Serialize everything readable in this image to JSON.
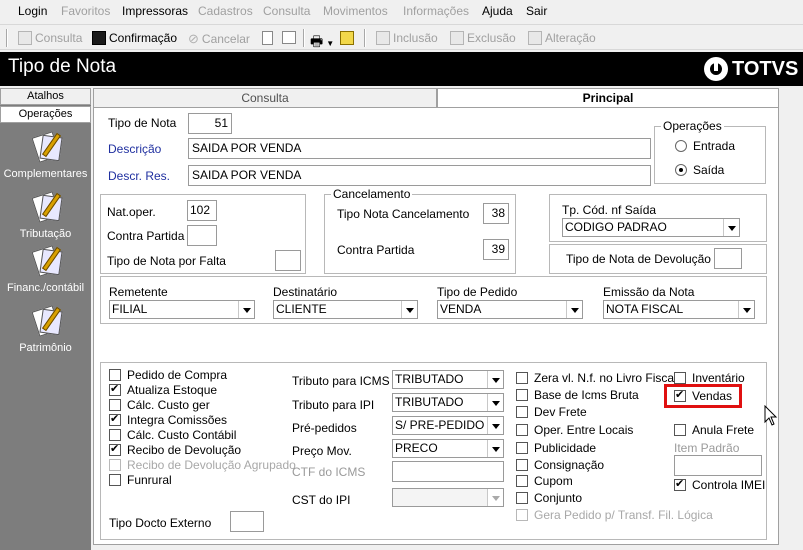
{
  "menu": {
    "items": [
      {
        "label": "Login",
        "enabled": true
      },
      {
        "label": "Favoritos",
        "enabled": false
      },
      {
        "label": "Impressoras",
        "enabled": true
      },
      {
        "label": "Cadastros",
        "enabled": false
      },
      {
        "label": "Consulta",
        "enabled": false
      },
      {
        "label": "Movimentos",
        "enabled": false
      },
      {
        "label": "Informações",
        "enabled": false
      },
      {
        "label": "Ajuda",
        "enabled": true
      },
      {
        "label": "Sair",
        "enabled": true
      }
    ]
  },
  "toolbar": {
    "consulta": "Consulta",
    "confirmacao": "Confirmação",
    "cancelar": "Cancelar",
    "inclusao": "Inclusão",
    "exclusao": "Exclusão",
    "alteracao": "Alteração"
  },
  "title_bar": {
    "title": "Tipo de Nota",
    "brand": "TOTVS"
  },
  "sidebar": {
    "tabs": [
      "Atalhos",
      "Operações"
    ],
    "items": [
      "Complementares",
      "Tributação",
      "Financ./contábil",
      "Patrimônio"
    ]
  },
  "tabs": {
    "consulta": "Consulta",
    "principal": "Principal"
  },
  "form": {
    "tipo_de_nota": {
      "label": "Tipo de Nota",
      "value": "51"
    },
    "descricao": {
      "label": "Descrição",
      "value": "SAIDA POR VENDA"
    },
    "descr_res": {
      "label": "Descr. Res.",
      "value": "SAIDA POR VENDA"
    },
    "operacoes": {
      "label": "Operações",
      "options": [
        "Entrada",
        "Saída"
      ],
      "selected": "Saída"
    },
    "nat_oper": {
      "label": "Nat.oper.",
      "value": "102"
    },
    "contra_partida": {
      "label": "Contra Partida",
      "value": ""
    },
    "tipo_nota_falta": {
      "label": "Tipo de Nota por Falta",
      "value": ""
    },
    "cancelamento": {
      "label": "Cancelamento",
      "tipo_nota_canc": {
        "label": "Tipo Nota Cancelamento",
        "value": "38"
      },
      "contra_partida": {
        "label": "Contra Partida",
        "value": "39"
      }
    },
    "tp_cod_nf_saida": {
      "label": "Tp. Cód. nf Saída",
      "value": "CODIGO PADRAO"
    },
    "tipo_nota_devolucao": {
      "label": "Tipo de Nota de Devolução",
      "value": ""
    },
    "remetente": {
      "label": "Remetente",
      "value": "FILIAL"
    },
    "destinatario": {
      "label": "Destinatário",
      "value": "CLIENTE"
    },
    "tipo_pedido": {
      "label": "Tipo de Pedido",
      "value": "VENDA"
    },
    "emissao_nota": {
      "label": "Emissão da Nota",
      "value": "NOTA FISCAL"
    },
    "checks_col1": [
      {
        "label": "Pedido de Compra",
        "checked": false,
        "enabled": true
      },
      {
        "label": "Atualiza Estoque",
        "checked": true,
        "enabled": true
      },
      {
        "label": "Cálc. Custo ger",
        "checked": false,
        "enabled": true
      },
      {
        "label": "Integra Comissões",
        "checked": true,
        "enabled": true
      },
      {
        "label": "Cálc. Custo Contábil",
        "checked": false,
        "enabled": true
      },
      {
        "label": "Recibo de Devolução",
        "checked": true,
        "enabled": true
      },
      {
        "label": "Recibo de Devolução Agrupado",
        "checked": false,
        "enabled": false
      },
      {
        "label": "Funrural",
        "checked": false,
        "enabled": true
      }
    ],
    "tipo_docto_externo": {
      "label": "Tipo Docto Externo",
      "value": ""
    },
    "tributo_icms": {
      "label": "Tributo para ICMS",
      "value": "TRIBUTADO"
    },
    "tributo_ipi": {
      "label": "Tributo para IPI",
      "value": "TRIBUTADO"
    },
    "pre_pedidos": {
      "label": "Pré-pedidos",
      "value": "S/ PRE-PEDIDO"
    },
    "preco_mov": {
      "label": "Preço Mov.",
      "value": "PRECO"
    },
    "ctf_icms": {
      "label": "CTF do ICMS",
      "value": ""
    },
    "cst_ipi": {
      "label": "CST do IPI",
      "value": ""
    },
    "checks_col3": [
      {
        "label": "Zera vl. N.f. no Livro Fiscal",
        "checked": false,
        "enabled": true
      },
      {
        "label": "Base de Icms Bruta",
        "checked": false,
        "enabled": true
      },
      {
        "label": "Dev Frete",
        "checked": false,
        "enabled": true
      },
      {
        "label": "Oper. Entre Locais",
        "checked": false,
        "enabled": true
      },
      {
        "label": "Publicidade",
        "checked": false,
        "enabled": true
      },
      {
        "label": "Consignação",
        "checked": false,
        "enabled": true
      },
      {
        "label": "Cupom",
        "checked": false,
        "enabled": true
      },
      {
        "label": "Conjunto",
        "checked": false,
        "enabled": true
      },
      {
        "label": "Gera Pedido p/ Transf. Fil. Lógica",
        "checked": false,
        "enabled": false
      }
    ],
    "inventario": {
      "label": "Inventário",
      "checked": false
    },
    "vendas": {
      "label": "Vendas",
      "checked": true
    },
    "anula_frete": {
      "label": "Anula Frete",
      "checked": false
    },
    "item_padrao": {
      "label": "Item Padrão",
      "value": ""
    },
    "controla_imei": {
      "label": "Controla IMEI",
      "checked": true
    }
  },
  "colors": {
    "highlight": "#e01010",
    "sidebar": "#7d7d7d",
    "titlebar": "#000000"
  }
}
